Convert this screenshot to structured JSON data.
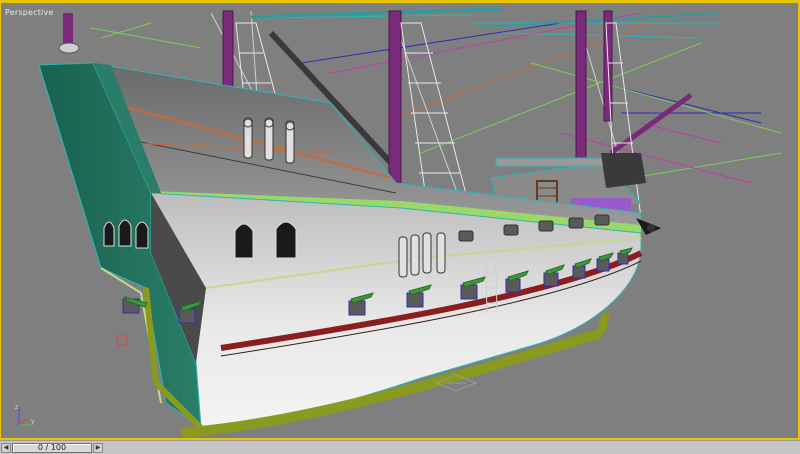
{
  "viewport": {
    "label": "Perspective",
    "border_color": "#e8c400",
    "background": "#7f7f7f"
  },
  "scene": {
    "subject": "galleon-3d-model",
    "icons": [
      "axis-tripod-icon",
      "light-target-icon",
      "pivot-gizmo-icon"
    ]
  },
  "timeline": {
    "slider_text": "0 / 100",
    "prev_icon": "arrow-left-icon",
    "next_icon": "arrow-right-icon"
  },
  "colors": {
    "hull_dark": "#5a5a5a",
    "hull_light": "#e6e6e6",
    "stern_teal": "#1f6e5c",
    "mast_purple": "#7a2a7a",
    "stripe_red": "#8a1e1e",
    "keel_olive": "#8a9a1e"
  }
}
